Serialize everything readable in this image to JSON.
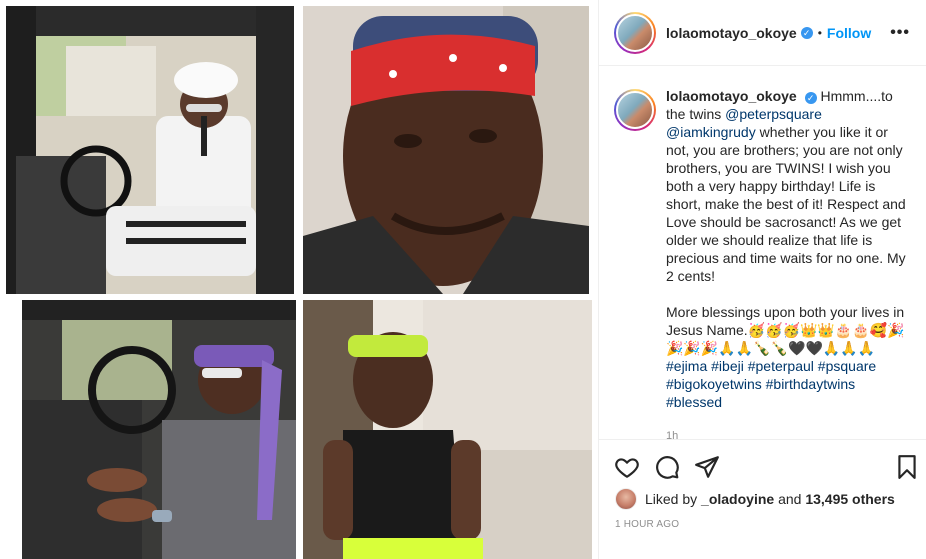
{
  "post": {
    "username": "lolaomotayo_okoye",
    "follow_label": "Follow",
    "dot": "•",
    "more_label": "•••",
    "verified_glyph": "✓",
    "caption": {
      "intro": "Hmmm....to the twins",
      "mention1": "@peterpsquare",
      "mention2": "@iamkingrudy",
      "body": "whether you like it or not, you are brothers; you are not only brothers, you are TWINS! I wish you both a very happy birthday! Life is short, make the best of it! Respect and Love should be sacrosanct! As we get older we should realize that life is precious and time waits for no one. My 2 cents!",
      "blessing": "More blessings upon both your lives in Jesus Name.",
      "emojis": "🥳🥳🥳👑👑🎂🎂🥰🎉🎉🎉🎉🙏🙏🍾🍾🖤🖤🙏🙏🙏",
      "hashtags": [
        "#ejima",
        "#ibeji",
        "#peterpaul",
        "#psquare",
        "#bigokoyetwins",
        "#birthdaytwins",
        "#blessed"
      ],
      "relative_time": "1h"
    },
    "likes": {
      "prefix": "Liked by",
      "user": "_oladoyine",
      "joiner": "and",
      "count": "13,495 others"
    },
    "post_time": "1 HOUR AGO"
  }
}
